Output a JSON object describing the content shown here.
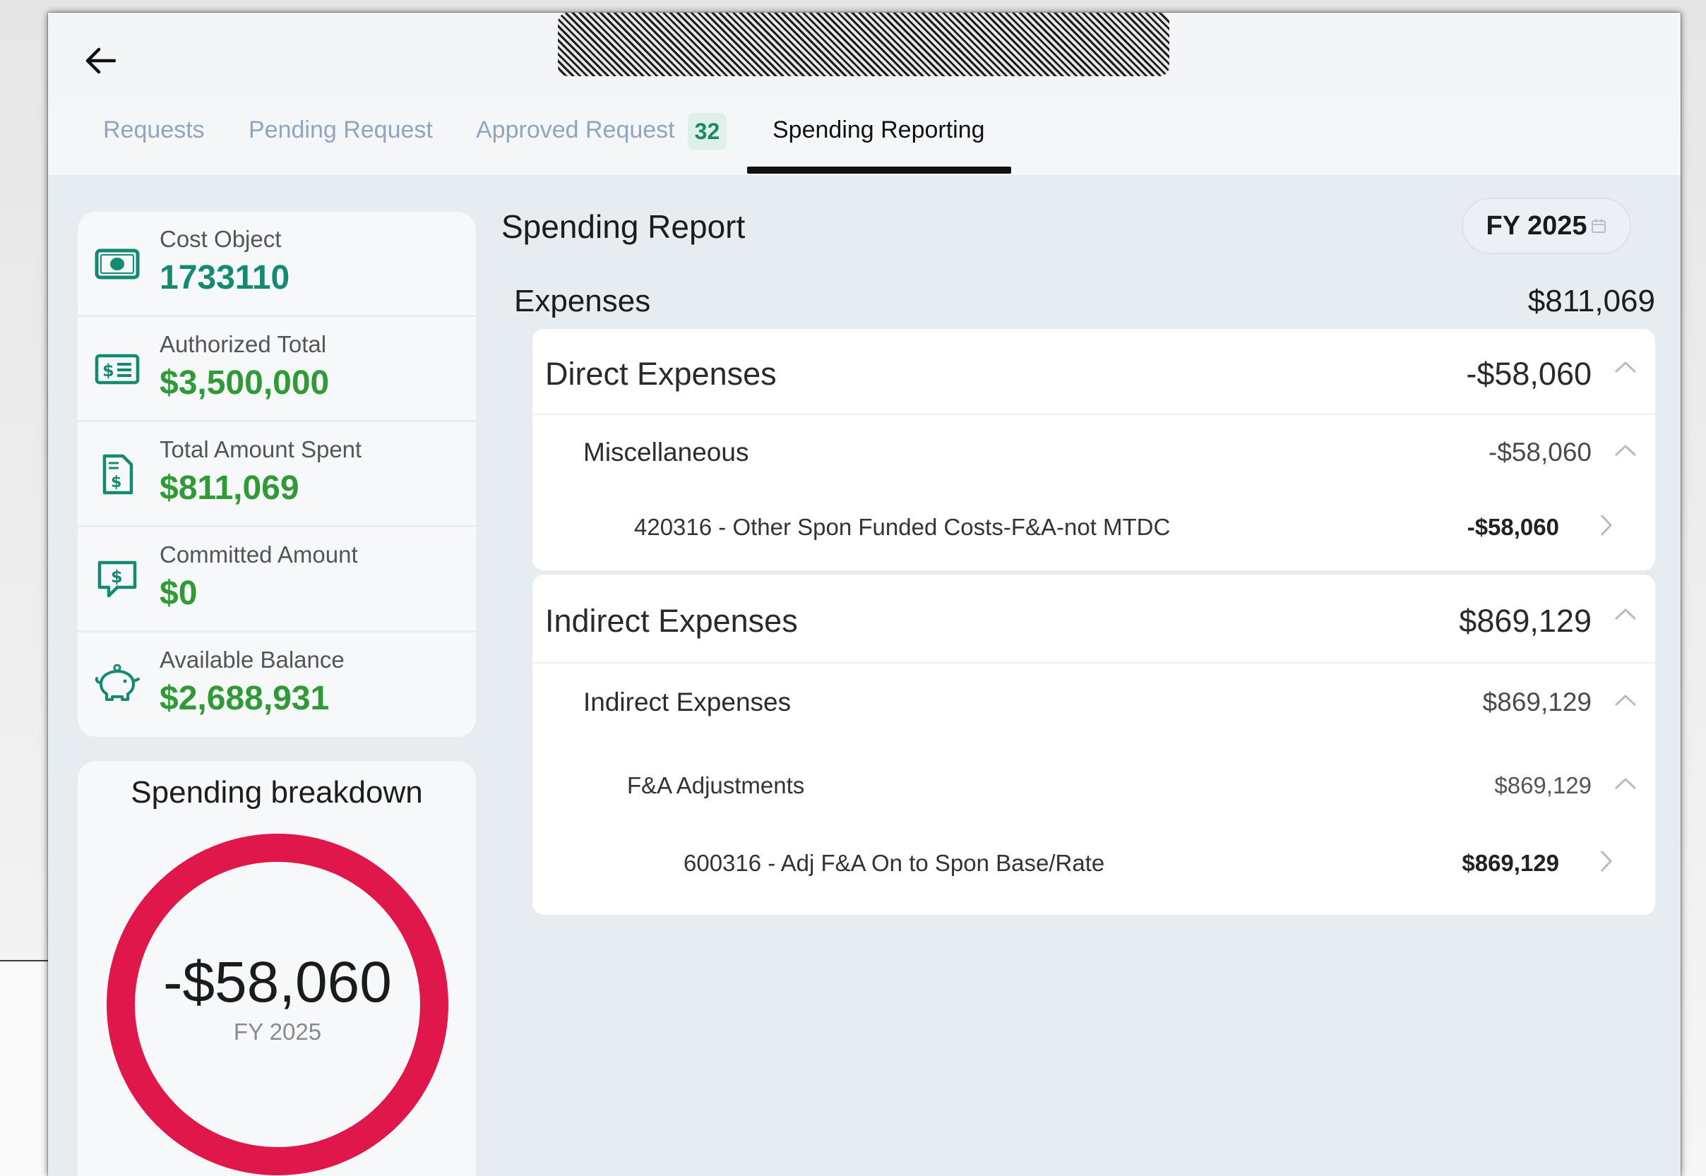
{
  "header": {
    "back_icon": "arrow-left-icon"
  },
  "tabs": [
    {
      "label": "Requests",
      "active": false
    },
    {
      "label": "Pending Request",
      "active": false
    },
    {
      "label": "Approved Request",
      "badge": "32",
      "active": false
    },
    {
      "label": "Spending Reporting",
      "active": true
    }
  ],
  "summary": [
    {
      "label": "Cost Object",
      "value": "1733110",
      "icon": "money-bill-icon",
      "color": "#138a71"
    },
    {
      "label": "Authorized Total",
      "value": "$3,500,000",
      "icon": "dollar-list-icon",
      "color": "#2f9a36"
    },
    {
      "label": "Total Amount Spent",
      "value": "$811,069",
      "icon": "receipt-dollar-icon",
      "color": "#2f9a36"
    },
    {
      "label": "Committed Amount",
      "value": "$0",
      "icon": "chat-dollar-icon",
      "color": "#2f9a36"
    },
    {
      "label": "Available Balance",
      "value": "$2,688,931",
      "icon": "piggy-bank-icon",
      "color": "#2f9a36"
    }
  ],
  "breakdown": {
    "title": "Spending breakdown",
    "value": "-$58,060",
    "period": "FY 2025",
    "ring_color": "#e0174a"
  },
  "report": {
    "title": "Spending Report",
    "fiscal_year": "FY 2025",
    "expenses_label": "Expenses",
    "expenses_total": "$811,069",
    "direct": {
      "label": "Direct Expenses",
      "amount": "-$58,060",
      "sub": {
        "label": "Miscellaneous",
        "amount": "-$58,060",
        "leaf": {
          "label": "420316 - Other Spon Funded Costs-F&A-not MTDC",
          "amount": "-$58,060"
        }
      }
    },
    "indirect": {
      "label": "Indirect Expenses",
      "amount": "$869,129",
      "sub": {
        "label": "Indirect Expenses",
        "amount": "$869,129",
        "sub": {
          "label": "F&A Adjustments",
          "amount": "$869,129",
          "leaf": {
            "label": "600316 - Adj F&A On to Spon Base/Rate",
            "amount": "$869,129"
          }
        }
      }
    }
  }
}
